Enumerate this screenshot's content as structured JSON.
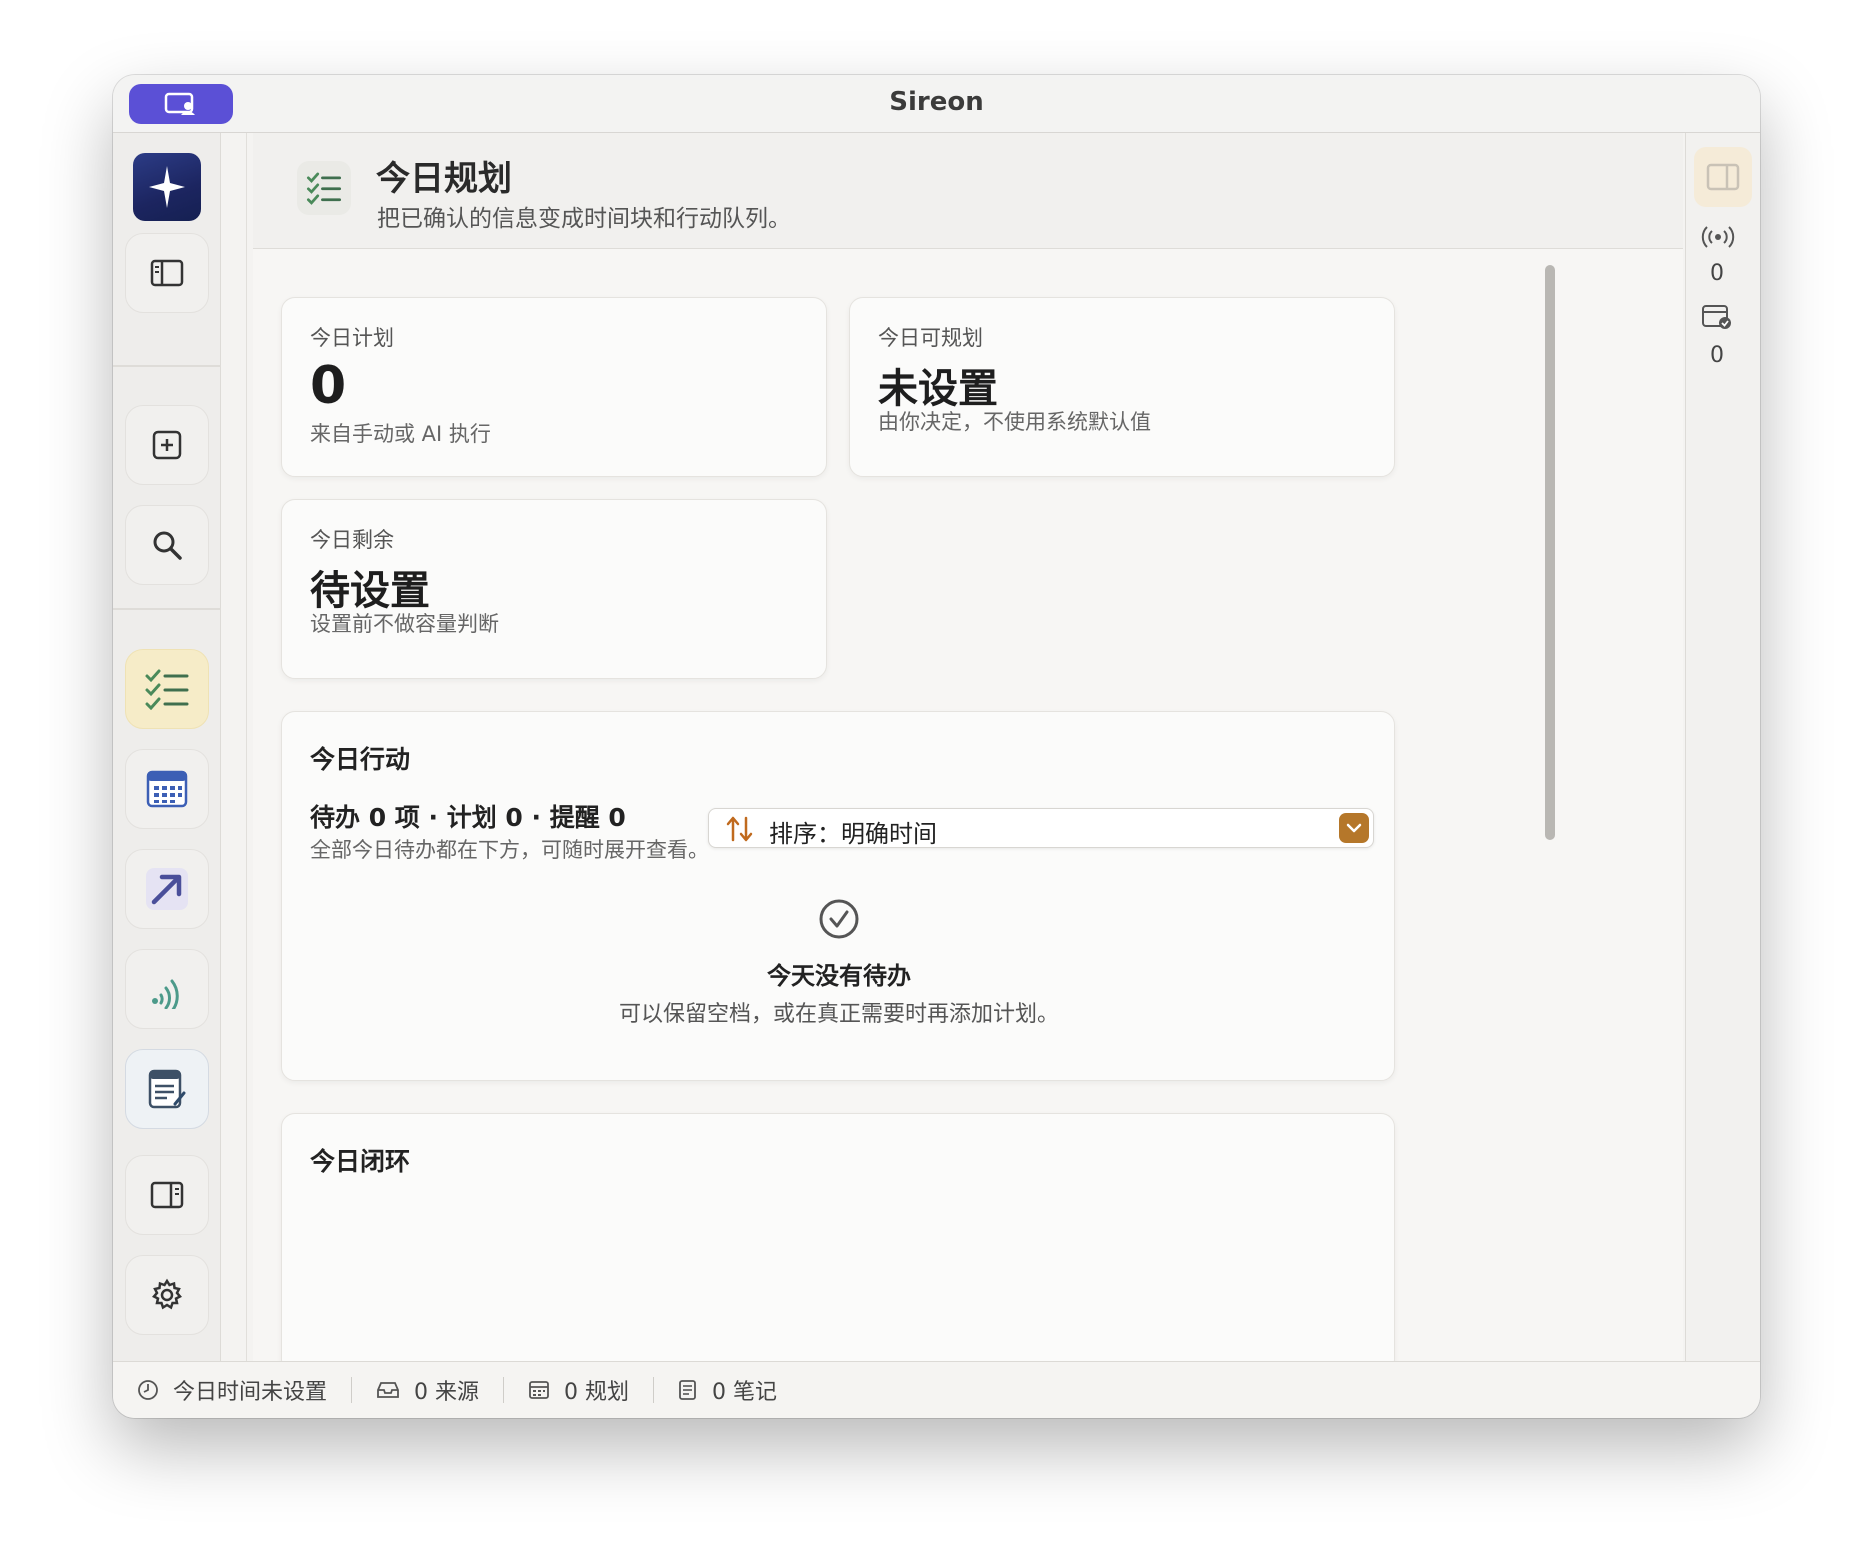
{
  "window": {
    "title": "Sireon"
  },
  "header": {
    "title": "今日规划",
    "subtitle": "把已确认的信息变成时间块和行动队列。"
  },
  "stats": [
    {
      "label": "今日计划",
      "value": "0",
      "desc": "来自手动或 AI 执行"
    },
    {
      "label": "今日可规划",
      "value": "未设置",
      "desc": "由你决定，不使用系统默认值"
    },
    {
      "label": "今日剩余",
      "value": "待设置",
      "desc": "设置前不做容量判断"
    }
  ],
  "actions": {
    "title": "今日行动",
    "counts": "待办 0 项 · 计划 0 · 提醒 0",
    "counts_sub": "全部今日待办都在下方，可随时展开查看。",
    "sort_label": "排序：明确时间",
    "empty_title": "今天没有待办",
    "empty_sub": "可以保留空档，或在真正需要时再添加计划。"
  },
  "closure": {
    "title": "今日闭环"
  },
  "right_panel": {
    "signal_count": "0",
    "calendar_count": "0"
  },
  "statusbar": {
    "time": "今日时间未设置",
    "sources": "0 来源",
    "plans": "0 规划",
    "notes": "0 笔记"
  },
  "colors": {
    "accent_purple": "#5b50d6",
    "active_nav": "#f6ecc8",
    "sort_chevron": "#b5772a",
    "check_green": "#4a8a5a"
  }
}
